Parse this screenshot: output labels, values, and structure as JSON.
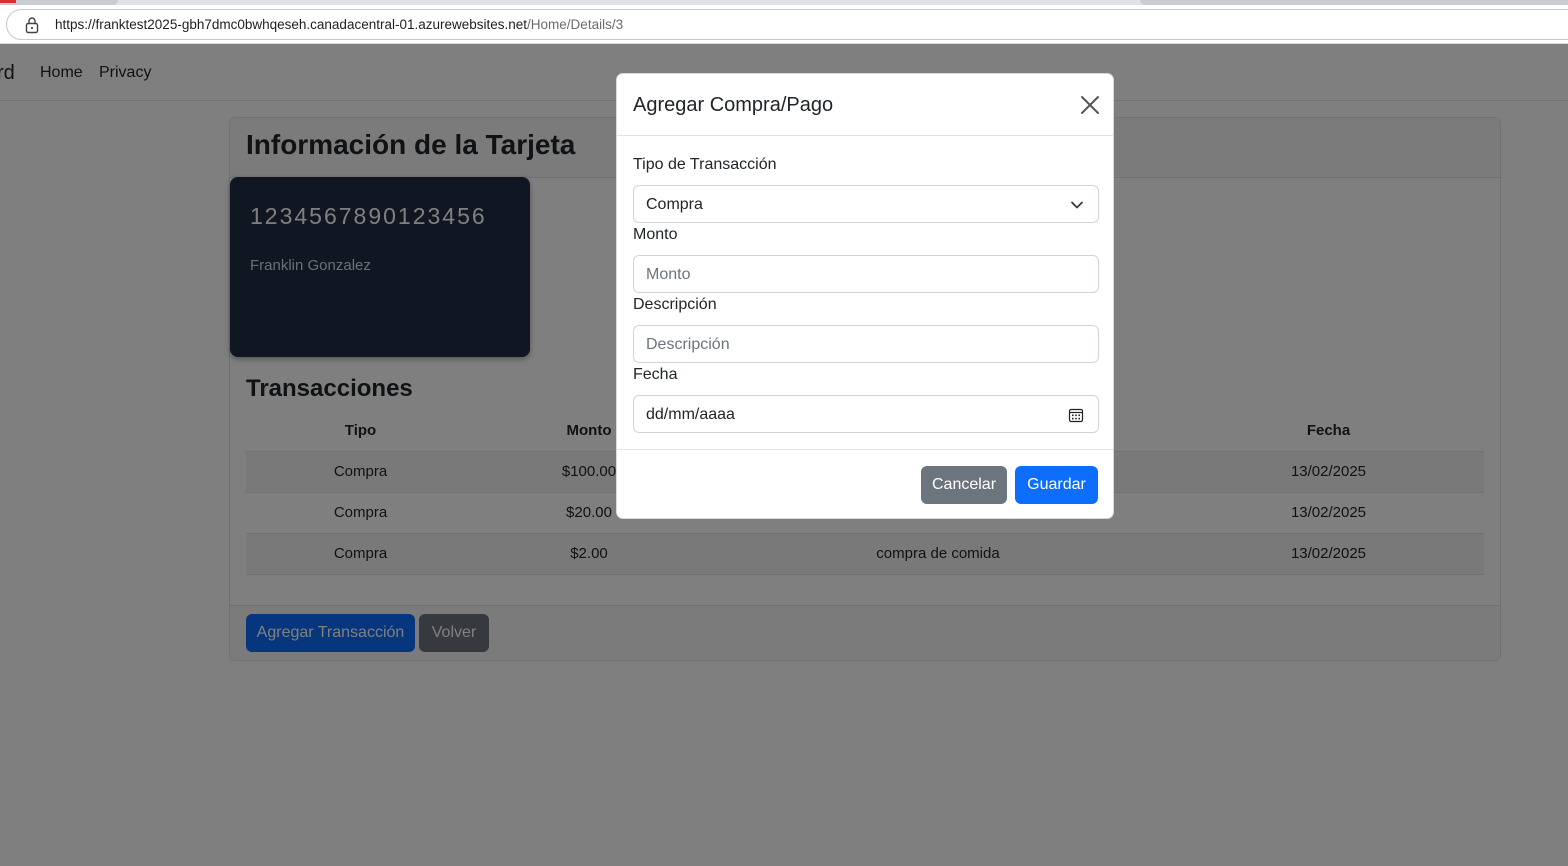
{
  "browser": {
    "url_host": "https://franktest2025-gbh7dmc0bwhqeseh.canadacentral-01.azurewebsites.net",
    "url_path": "/Home/Details/3"
  },
  "nav": {
    "brand": "rd",
    "links": [
      "Home",
      "Privacy"
    ]
  },
  "card_panel": {
    "title": "Información de la Tarjeta",
    "card": {
      "number": "1234567890123456",
      "holder": "Franklin Gonzalez",
      "color": "#212e44"
    },
    "transactions_title": "Transacciones",
    "table": {
      "headers": [
        "Tipo",
        "Monto",
        "",
        "Fecha"
      ],
      "rows": [
        [
          "Compra",
          "$100.00",
          "",
          "13/02/2025"
        ],
        [
          "Compra",
          "$20.00",
          "",
          "13/02/2025"
        ],
        [
          "Compra",
          "$2.00",
          "compra de comida",
          "13/02/2025"
        ]
      ]
    },
    "buttons": {
      "add": "Agregar Transacción",
      "back": "Volver"
    }
  },
  "modal": {
    "title": "Agregar Compra/Pago",
    "fields": {
      "type_label": "Tipo de Transacción",
      "type_value": "Compra",
      "amount_label": "Monto",
      "amount_placeholder": "Monto",
      "description_label": "Descripción",
      "description_placeholder": "Descripción",
      "date_label": "Fecha",
      "date_placeholder": "dd/mm/aaaa"
    },
    "buttons": {
      "cancel": "Cancelar",
      "save": "Guardar"
    }
  },
  "colors": {
    "primary": "#0d6efd",
    "secondary": "#6c757d"
  }
}
